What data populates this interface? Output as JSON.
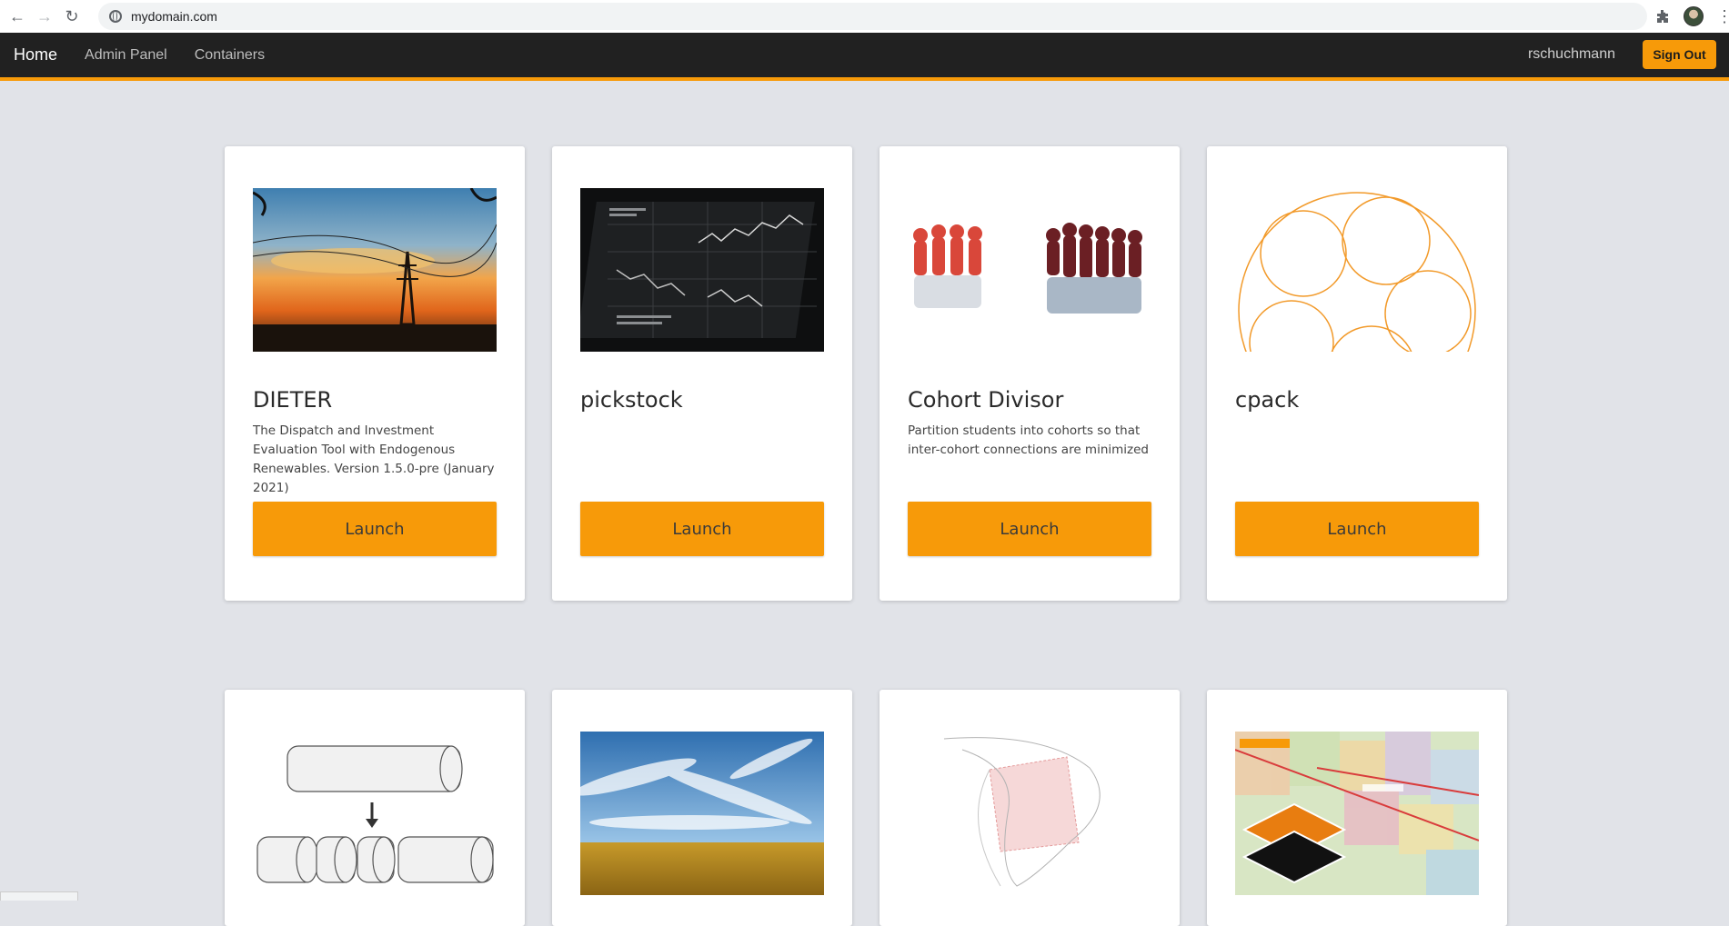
{
  "browser": {
    "url": "mydomain.com",
    "icons": [
      "back-arrow-icon",
      "forward-arrow-icon",
      "reload-icon",
      "site-info-icon",
      "extensions-icon",
      "profile-avatar",
      "menu-kebab-icon"
    ]
  },
  "navbar": {
    "home": "Home",
    "links": [
      "Admin Panel",
      "Containers"
    ],
    "username": "rschuchmann",
    "signout_label": "Sign Out",
    "accent_color": "#f79a09",
    "bar_color": "#212121"
  },
  "cards": [
    {
      "title": "DIETER",
      "description": "The Dispatch and Investment Evaluation Tool with Endogenous Renewables. Version 1.5.0-pre (January 2021)",
      "launch_label": "Launch",
      "image": "sunset-power-lines-image"
    },
    {
      "title": "pickstock",
      "description": "",
      "launch_label": "Launch",
      "image": "stock-charts-image"
    },
    {
      "title": "Cohort Divisor",
      "description": "Partition students into cohorts so that inter-cohort connections are minimized",
      "launch_label": "Launch",
      "image": "pawn-groups-image"
    },
    {
      "title": "cpack",
      "description": "",
      "launch_label": "Launch",
      "image": "circle-packing-image"
    },
    {
      "image": "paper-rolls-image"
    },
    {
      "image": "wheat-field-sky-image"
    },
    {
      "image": "projection-sketch-image"
    },
    {
      "image": "us-map-layers-image"
    }
  ]
}
